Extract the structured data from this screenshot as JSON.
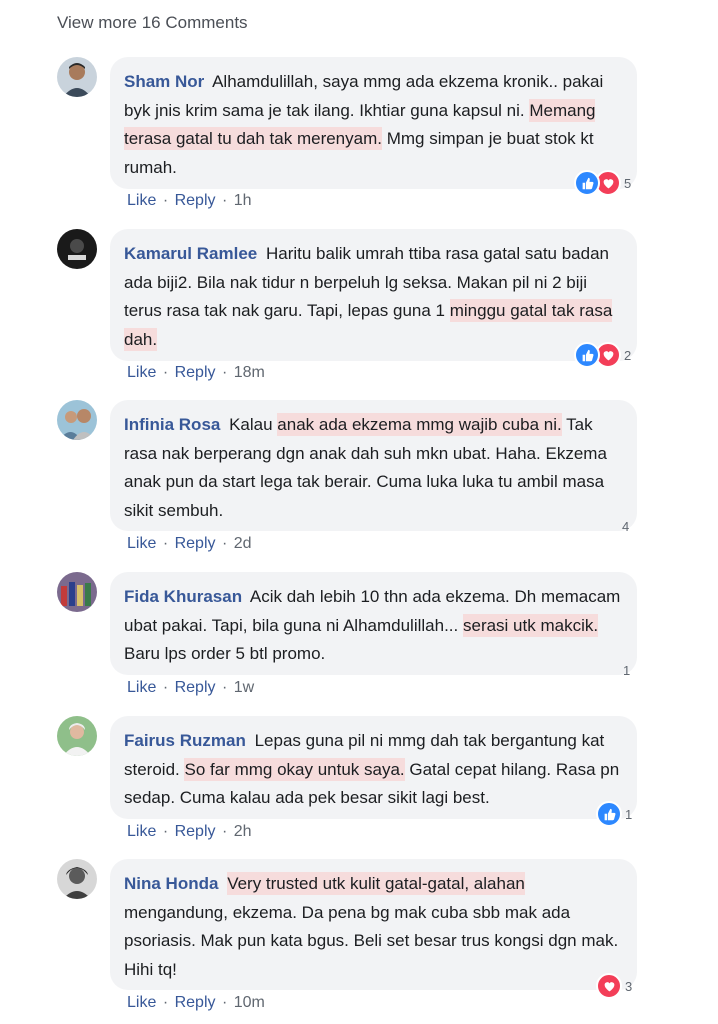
{
  "view_more_label": "View more 16 Comments",
  "actions": {
    "like": "Like",
    "reply": "Reply",
    "dot": "·"
  },
  "colors": {
    "author": "#385898",
    "highlight": "#f6dcdc",
    "like": "#2d88ff",
    "love": "#f33e58",
    "bubble": "#f2f3f5"
  },
  "comments": [
    {
      "author": "Sham Nor",
      "text_a": "Alhamdulillah, saya mmg ada ekzema kronik.. pakai byk jnis krim sama je tak ilang. Ikhtiar guna kapsul ni. ",
      "highlight": "Memang terasa gatal tu dah tak merenyam.",
      "text_b": " Mmg simpan je buat stok kt rumah.",
      "time": "1h",
      "reactions": [
        "like-icon",
        "heart-icon"
      ],
      "reaction_count": "5"
    },
    {
      "author": "Kamarul Ramlee",
      "text_a": "Haritu balik umrah ttiba rasa gatal satu badan ada biji2. Bila nak tidur n berpeluh lg seksa. Makan pil ni 2 biji terus rasa tak nak garu. Tapi, lepas guna 1 ",
      "highlight": "minggu gatal tak rasa dah.",
      "text_b": "",
      "time": "18m",
      "reactions": [
        "like-icon",
        "heart-icon"
      ],
      "reaction_count": "2"
    },
    {
      "author": "Infinia Rosa",
      "text_a": "Kalau ",
      "highlight": "anak ada ekzema mmg wajib cuba ni.",
      "text_b": " Tak rasa nak berperang dgn anak dah suh mkn ubat. Haha. Ekzema anak pun da start lega tak berair. Cuma luka luka tu ambil masa sikit sembuh.",
      "time": "2d",
      "reactions": [],
      "reaction_count": "4"
    },
    {
      "author": "Fida Khurasan",
      "text_a": "Acik dah lebih 10 thn ada ekzema. Dh memacam ubat pakai. Tapi, bila guna ni Alhamdulillah... ",
      "highlight": "serasi utk makcik.",
      "text_b": " Baru lps order 5 btl promo.",
      "time": "1w",
      "reactions": [],
      "reaction_count": "1"
    },
    {
      "author": "Fairus Ruzman",
      "text_a": "Lepas guna pil ni mmg dah tak bergantung kat steroid. ",
      "highlight": "So far mmg okay untuk saya.",
      "text_b": " Gatal cepat hilang. Rasa pn sedap. Cuma kalau ada pek besar sikit lagi best.",
      "time": "2h",
      "reactions": [
        "like-icon"
      ],
      "reaction_count": "1"
    },
    {
      "author": "Nina Honda",
      "text_a": "",
      "highlight": "Very trusted utk kulit gatal-gatal, alahan",
      "text_b": " mengandung, ekzema. Da pena bg mak cuba sbb mak ada psoriasis. Mak pun kata bgus. Beli set besar trus kongsi dgn mak. Hihi tq!",
      "time": "10m",
      "reactions": [
        "heart-icon"
      ],
      "reaction_count": "3"
    }
  ]
}
